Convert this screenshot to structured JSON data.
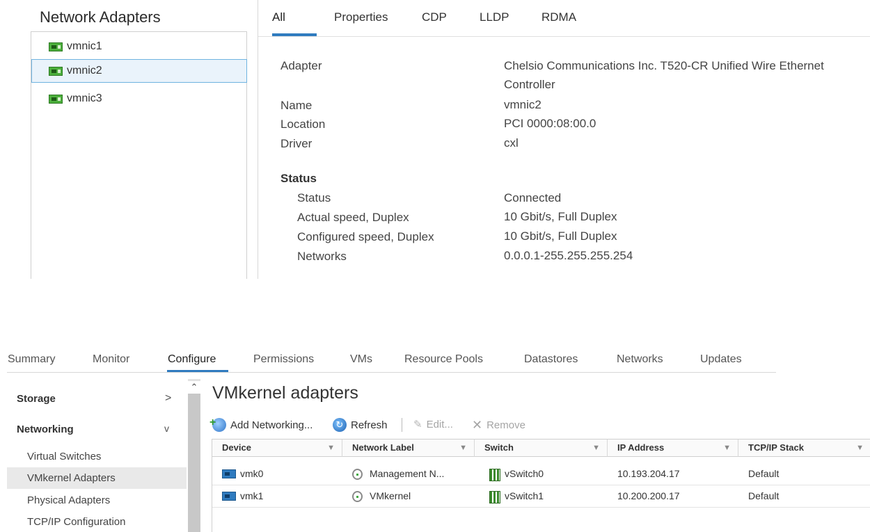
{
  "network_adapters": {
    "title": "Network Adapters",
    "items": [
      {
        "label": "vmnic1",
        "selected": false
      },
      {
        "label": "vmnic2",
        "selected": true
      },
      {
        "label": "vmnic3",
        "selected": false
      }
    ]
  },
  "details_tabs": [
    "All",
    "Properties",
    "CDP",
    "LLDP",
    "RDMA"
  ],
  "details_active_tab": "All",
  "details": {
    "adapter_label": "Adapter",
    "adapter_value": "Chelsio Communications Inc. T520-CR Unified Wire Ethernet Controller",
    "name_label": "Name",
    "name_value": "vmnic2",
    "location_label": "Location",
    "location_value": "PCI 0000:08:00.0",
    "driver_label": "Driver",
    "driver_value": "cxl",
    "status_section": "Status",
    "status_label": "Status",
    "status_value": "Connected",
    "actual_speed_label": "Actual speed, Duplex",
    "actual_speed_value": "10 Gbit/s, Full Duplex",
    "configured_speed_label": "Configured speed, Duplex",
    "configured_speed_value": "10 Gbit/s, Full Duplex",
    "networks_label": "Networks",
    "networks_value": "0.0.0.1-255.255.255.254"
  },
  "main_tabs": [
    "Summary",
    "Monitor",
    "Configure",
    "Permissions",
    "VMs",
    "Resource Pools",
    "Datastores",
    "Networks",
    "Updates"
  ],
  "main_active_tab": "Configure",
  "sidebar": {
    "storage": {
      "label": "Storage",
      "chevron": ">"
    },
    "networking": {
      "label": "Networking",
      "chevron": "v"
    },
    "items": [
      {
        "label": "Virtual Switches",
        "active": false
      },
      {
        "label": "VMkernel Adapters",
        "active": true
      },
      {
        "label": "Physical Adapters",
        "active": false
      },
      {
        "label": "TCP/IP Configuration",
        "active": false
      }
    ]
  },
  "vmkernel": {
    "title": "VMkernel adapters",
    "toolbar": {
      "add": "Add Networking...",
      "refresh": "Refresh",
      "edit": "Edit...",
      "remove": "Remove"
    },
    "columns": [
      "Device",
      "Network Label",
      "Switch",
      "IP Address",
      "TCP/IP Stack"
    ],
    "rows": [
      {
        "device": "vmk0",
        "network_label": "Management N...",
        "switch": "vSwitch0",
        "ip": "10.193.204.17",
        "stack": "Default"
      },
      {
        "device": "vmk1",
        "network_label": "VMkernel",
        "switch": "vSwitch1",
        "ip": "10.200.200.17",
        "stack": "Default"
      }
    ]
  },
  "colors": {
    "accent": "#2f7bbf",
    "selection_bg": "#eaf3fb",
    "selection_border": "#6fb3e0",
    "nic_icon": "#4caf3c"
  },
  "icons": {
    "nic": "nic-icon",
    "vmk": "vmkernel-adapter-icon",
    "network_label": "port-group-icon",
    "switch": "vswitch-icon",
    "add": "add-networking-icon",
    "refresh": "refresh-icon",
    "edit": "pencil-icon",
    "remove": "close-icon",
    "filter": "filter-icon"
  }
}
